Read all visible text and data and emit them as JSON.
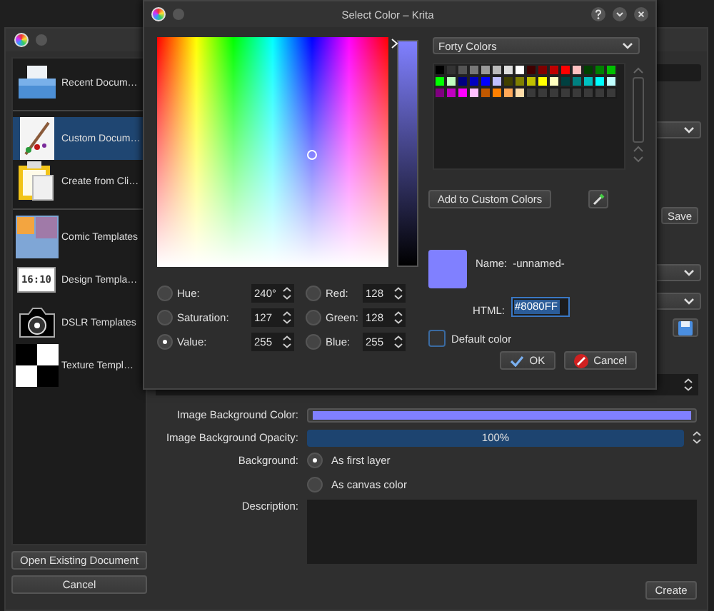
{
  "new_document_window": {
    "templates": [
      [
        {
          "label": "Recent Docum…",
          "selected": false
        }
      ],
      [
        {
          "label": "Custom Docum…",
          "selected": true
        },
        {
          "label": "Create from Cli…",
          "selected": false
        }
      ],
      [
        {
          "label": "Comic Templates",
          "selected": false
        },
        {
          "label": "Design Templa…",
          "selected": false,
          "icon_text": "16:10"
        },
        {
          "label": "DSLR Templates",
          "selected": false
        },
        {
          "label": "Texture Templ…",
          "selected": false
        }
      ]
    ],
    "open_button": "Open Existing Document",
    "cancel_button": "Cancel",
    "top_controls": [
      {
        "kind": "field"
      },
      {
        "kind": "dropdown"
      },
      {
        "kind": "button",
        "label": "Save"
      },
      {
        "kind": "dropdown"
      },
      {
        "kind": "dropdown"
      },
      {
        "kind": "save-button"
      },
      {
        "kind": "spinbox"
      }
    ],
    "background_color_label": "Image Background Color:",
    "opacity_label": "Image Background Opacity:",
    "opacity": {
      "level": 1,
      "reading": "100%"
    },
    "background_label": "Background:",
    "background_options": [
      {
        "label": "As first layer",
        "selected": true
      },
      {
        "label": "As canvas color",
        "selected": false
      }
    ],
    "description_label": "Description:",
    "create_button": "Create"
  },
  "color_dialog": {
    "title": "Select Color – Krita",
    "palette": "Forty Colors",
    "swatches": [
      {
        "color": "#000000"
      },
      {
        "color": "#333333"
      },
      {
        "color": "#555555"
      },
      {
        "color": "#777777"
      },
      {
        "color": "#999999"
      },
      {
        "color": "#bbbbbb"
      },
      {
        "color": "#dddddd"
      },
      {
        "color": "#ffffff"
      },
      {
        "color": "#400000"
      },
      {
        "color": "#800000"
      },
      {
        "color": "#c00000"
      },
      {
        "color": "#ff0000"
      },
      {
        "color": "#ffc0c0"
      },
      {
        "color": "#004000"
      },
      {
        "color": "#008000"
      },
      {
        "color": "#00c000"
      },
      {
        "color": "#00ff00"
      },
      {
        "color": "#c0ffc0"
      },
      {
        "color": "#000080"
      },
      {
        "color": "#0000c0"
      },
      {
        "color": "#0000ff"
      },
      {
        "color": "#c0c0ff"
      },
      {
        "color": "#404000"
      },
      {
        "color": "#808000"
      },
      {
        "color": "#c0c000"
      },
      {
        "color": "#ffff00"
      },
      {
        "color": "#ffffc0"
      },
      {
        "color": "#004040"
      },
      {
        "color": "#008080"
      },
      {
        "color": "#00c0c0"
      },
      {
        "color": "#00ffff"
      },
      {
        "color": "#c0ffff"
      },
      {
        "color": "#800080"
      },
      {
        "color": "#c000c0"
      },
      {
        "color": "#ff00ff"
      },
      {
        "color": "#ffc0ff"
      },
      {
        "color": "#c05800"
      },
      {
        "color": "#ff8000"
      },
      {
        "color": "#ffa858"
      },
      {
        "color": "#ffdca8"
      }
    ],
    "value_slider": {
      "level": 1
    },
    "add_button": "Add to Custom Colors",
    "channels": [
      {
        "label": "Hue:",
        "value": "240°",
        "selected": false
      },
      {
        "label": "Saturation:",
        "value": "127",
        "selected": false
      },
      {
        "label": "Value:",
        "value": "255",
        "selected": true
      },
      {
        "label": "Red:",
        "value": "128",
        "selected": false
      },
      {
        "label": "Green:",
        "value": "128",
        "selected": false
      },
      {
        "label": "Blue:",
        "value": "255",
        "selected": false
      }
    ],
    "name_label": "Name:",
    "name": "-unnamed-",
    "html_label": "HTML:",
    "html": "#8080FF",
    "default_color": {
      "label": "Default color",
      "checked": false
    },
    "ok_button": "OK",
    "cancel_button": "Cancel"
  }
}
